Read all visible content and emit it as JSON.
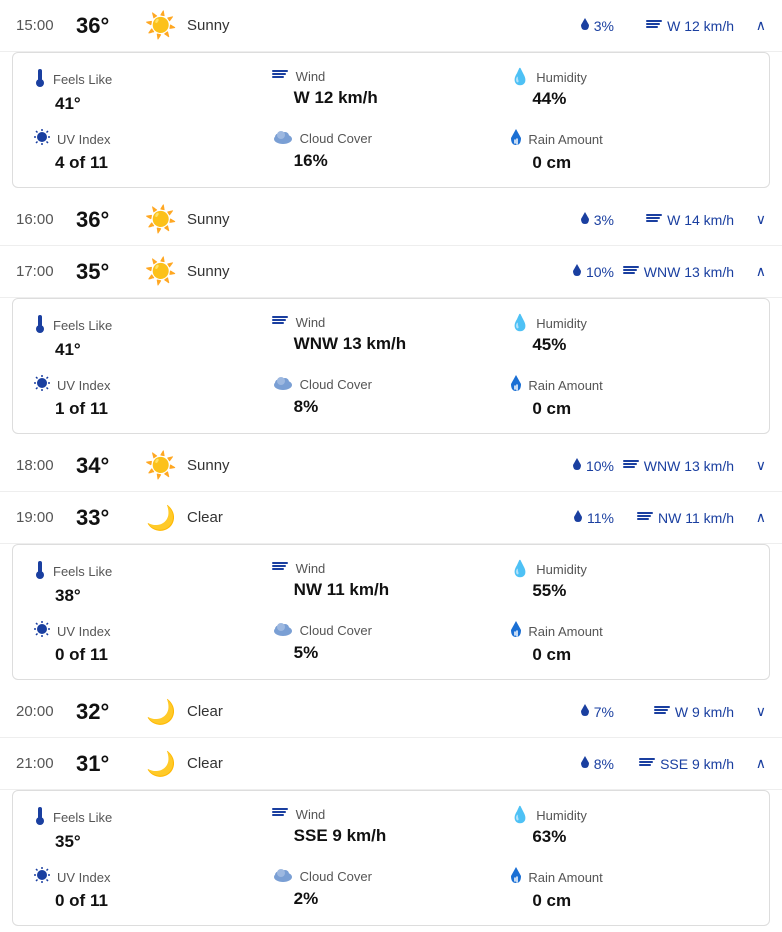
{
  "rows": [
    {
      "id": "row-1500",
      "time": "15:00",
      "temp": "36°",
      "icon": "sun",
      "condition": "Sunny",
      "rain": "3%",
      "wind": "W 12 km/h",
      "expanded": false,
      "chevron": "up",
      "detail": {
        "feels_like_label": "Feels Like",
        "feels_like_value": "41°",
        "wind_label": "Wind",
        "wind_value": "W 12 km/h",
        "humidity_label": "Humidity",
        "humidity_value": "44%",
        "uv_label": "UV Index",
        "uv_value": "4 of 11",
        "cloud_label": "Cloud Cover",
        "cloud_value": "16%",
        "rain_label": "Rain Amount",
        "rain_value": "0 cm"
      }
    },
    {
      "id": "row-1600",
      "time": "16:00",
      "temp": "36°",
      "icon": "sun",
      "condition": "Sunny",
      "rain": "3%",
      "wind": "W 14 km/h",
      "expanded": false,
      "chevron": "down",
      "detail": null
    },
    {
      "id": "row-1700",
      "time": "17:00",
      "temp": "35°",
      "icon": "sun",
      "condition": "Sunny",
      "rain": "10%",
      "wind": "WNW 13 km/h",
      "expanded": true,
      "chevron": "up",
      "detail": {
        "feels_like_label": "Feels Like",
        "feels_like_value": "41°",
        "wind_label": "Wind",
        "wind_value": "WNW 13 km/h",
        "humidity_label": "Humidity",
        "humidity_value": "45%",
        "uv_label": "UV Index",
        "uv_value": "1 of 11",
        "cloud_label": "Cloud Cover",
        "cloud_value": "8%",
        "rain_label": "Rain Amount",
        "rain_value": "0 cm"
      }
    },
    {
      "id": "row-1800",
      "time": "18:00",
      "temp": "34°",
      "icon": "sun",
      "condition": "Sunny",
      "rain": "10%",
      "wind": "WNW 13 km/h",
      "expanded": false,
      "chevron": "down",
      "detail": null
    },
    {
      "id": "row-1900",
      "time": "19:00",
      "temp": "33°",
      "icon": "moon",
      "condition": "Clear",
      "rain": "11%",
      "wind": "NW 11 km/h",
      "expanded": true,
      "chevron": "up",
      "detail": {
        "feels_like_label": "Feels Like",
        "feels_like_value": "38°",
        "wind_label": "Wind",
        "wind_value": "NW 11 km/h",
        "humidity_label": "Humidity",
        "humidity_value": "55%",
        "uv_label": "UV Index",
        "uv_value": "0 of 11",
        "cloud_label": "Cloud Cover",
        "cloud_value": "5%",
        "rain_label": "Rain Amount",
        "rain_value": "0 cm"
      }
    },
    {
      "id": "row-2000",
      "time": "20:00",
      "temp": "32°",
      "icon": "moon",
      "condition": "Clear",
      "rain": "7%",
      "wind": "W 9 km/h",
      "expanded": false,
      "chevron": "down",
      "detail": null
    },
    {
      "id": "row-2100",
      "time": "21:00",
      "temp": "31°",
      "icon": "moon",
      "condition": "Clear",
      "rain": "8%",
      "wind": "SSE 9 km/h",
      "expanded": true,
      "chevron": "up",
      "detail": {
        "feels_like_label": "Feels Like",
        "feels_like_value": "35°",
        "wind_label": "Wind",
        "wind_value": "SSE 9 km/h",
        "humidity_label": "Humidity",
        "humidity_value": "63%",
        "uv_label": "UV Index",
        "uv_value": "0 of 11",
        "cloud_label": "Cloud Cover",
        "cloud_value": "2%",
        "rain_label": "Rain Amount",
        "rain_value": "0 cm"
      }
    }
  ]
}
